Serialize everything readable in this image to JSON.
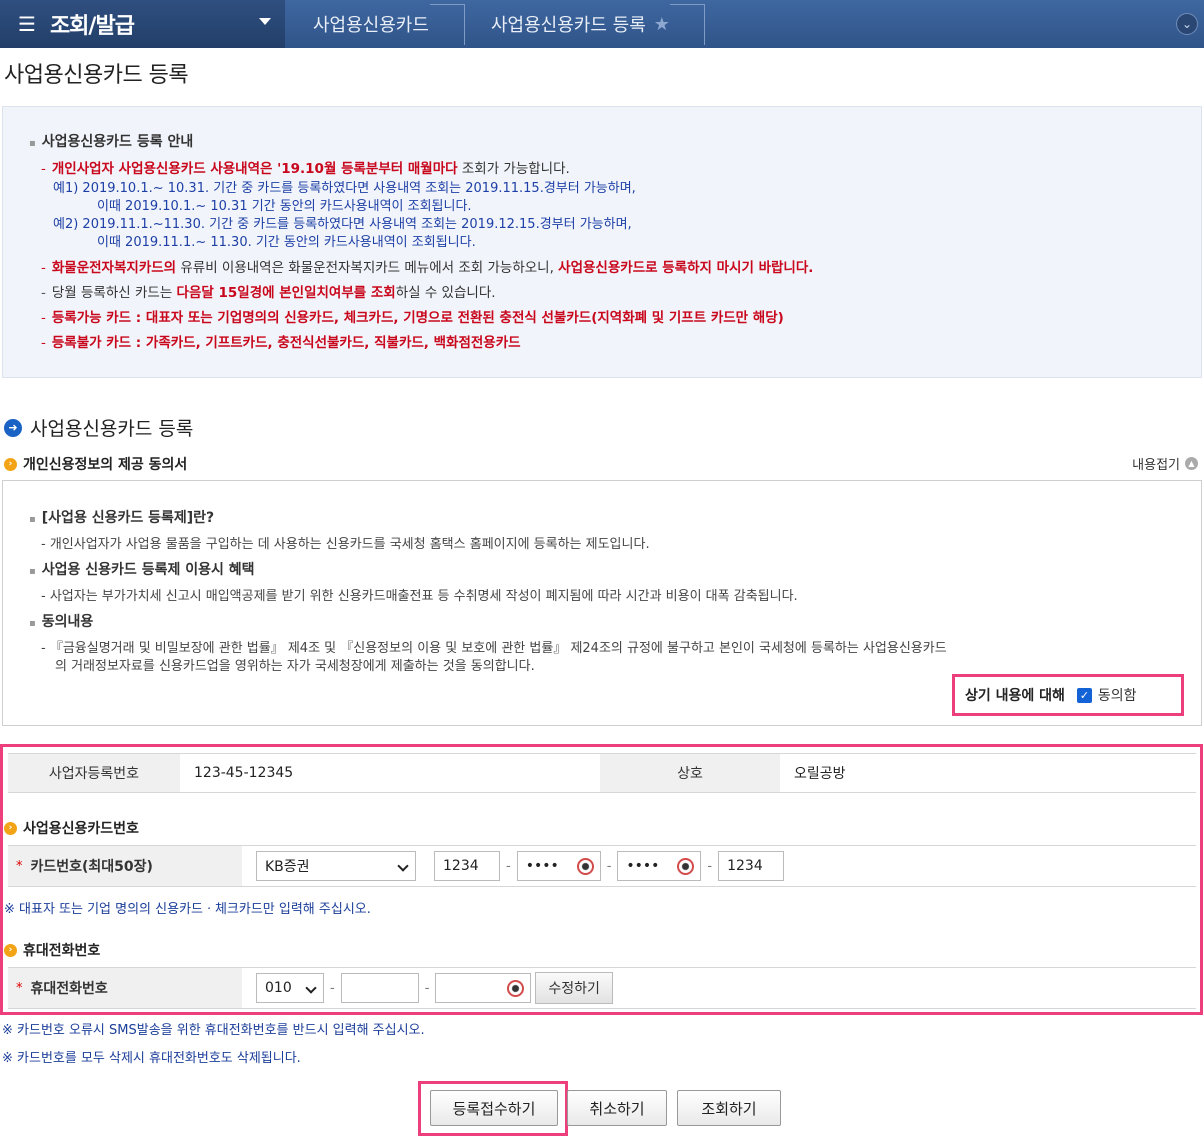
{
  "nav": {
    "menu_title": "조회/발급",
    "crumb1": "사업용신용카드",
    "crumb2": "사업용신용카드 등록"
  },
  "page_title": "사업용신용카드 등록",
  "guide": {
    "heading": "사업용신용카드 등록 안내",
    "l1_red": "개인사업자 사업용신용카드 사용내역은 '19.10월 등록분부터 매월마다",
    "l1_rest": " 조회가 가능합니다.",
    "ex1a": "예1) 2019.10.1.~ 10.31. 기간 중 카드를 등록하였다면 사용내역 조회는 2019.11.15.경부터 가능하며,",
    "ex1b": "이때 2019.10.1.~ 10.31 기간 동안의 카드사용내역이 조회됩니다.",
    "ex2a": "예2) 2019.11.1.~11.30. 기간 중 카드를 등록하였다면 사용내역 조회는 2019.12.15.경부터 가능하며,",
    "ex2b": "이때 2019.11.1.~ 11.30. 기간 동안의 카드사용내역이 조회됩니다.",
    "l2_red1": "화물운전자복지카드의",
    "l2_mid": " 유류비 이용내역은 화물운전자복지카드 메뉴에서 조회 가능하오니, ",
    "l2_red2": "사업용신용카드로 등록하지 마시기 바랍니다.",
    "l3_a": "당월 등록하신 카드는 ",
    "l3_red": "다음달 15일경에 본인일치여부를 조회",
    "l3_b": "하실 수 있습니다.",
    "l4": "등록가능 카드 : 대표자 또는 기업명의의 신용카드, 체크카드, 기명으로 전환된 충전식 선불카드(지역화폐 및 기프트 카드만 해당)",
    "l5": "등록불가 카드 : 가족카드, 기프트카드, 충전식선불카드, 직불카드, 백화점전용카드"
  },
  "section_title": "사업용신용카드 등록",
  "consent": {
    "title": "개인신용정보의 제공 동의서",
    "fold": "내용접기",
    "h1": "[사업용 신용카드 등록제]란?",
    "t1": "- 개인사업자가 사업용 물품을 구입하는 데 사용하는 신용카드를 국세청 홈택스 홈페이지에 등록하는 제도입니다.",
    "h2": "사업용 신용카드 등록제 이용시 혜택",
    "t2": "- 사업자는 부가가치세 신고시 매입액공제를 받기 위한 신용카드매출전표 등 수취명세 작성이 폐지됨에 따라 시간과 비용이 대폭 감축됩니다.",
    "h3": "동의내용",
    "t3a": "- 『금융실명거래 및 비밀보장에 관한 법률』 제4조 및 『신용정보의 이용 및 보호에 관한 법률』 제24조의 규정에 불구하고 본인이 국세청에 등록하는 사업용신용카드",
    "t3b": "의    거래정보자료를 신용카드업을 영위하는 자가 국세청장에게 제출하는 것을 동의합니다.",
    "agree_label": "상기 내용에 대해",
    "agree_check": "동의함"
  },
  "form": {
    "biz_no_label": "사업자등록번호",
    "biz_no": "123-45-12345",
    "name_label": "상호",
    "name": "오릴공방",
    "card_section": "사업용신용카드번호",
    "card_label": "카드번호(최대50장)",
    "card_company": "KB증권",
    "card1": "1234",
    "card2": "••••",
    "card3": "••••",
    "card4": "1234",
    "card_note": "※ 대표자 또는 기업 명의의 신용카드ㆍ체크카드만 입력해 주십시오.",
    "phone_section": "휴대전화번호",
    "phone_label": "휴대전화번호",
    "phone1": "010",
    "modify": "수정하기"
  },
  "notes": {
    "n1": "※ 카드번호 오류시 SMS발송을 위한 휴대전화번호를 반드시 입력해 주십시오.",
    "n2": "※ 카드번호를 모두 삭제시 휴대전화번호도 삭제됩니다."
  },
  "buttons": {
    "submit": "등록접수하기",
    "cancel": "취소하기",
    "inquiry": "조회하기"
  },
  "colors": {
    "accent_pink": "#ee3f7d",
    "nav_blue": "#2f5489",
    "red_text": "#c9071c"
  }
}
